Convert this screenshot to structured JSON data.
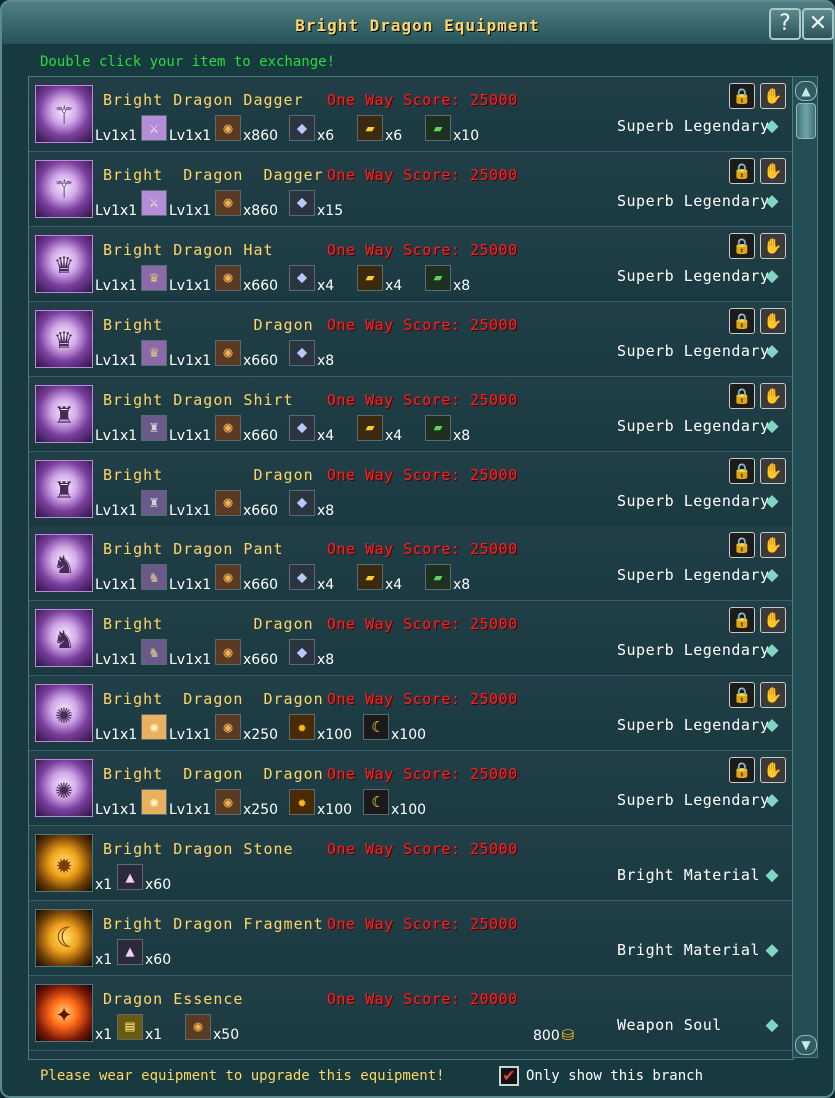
{
  "window": {
    "title": "Bright Dragon Equipment",
    "help_label": "?",
    "close_label": "✕"
  },
  "hint": "Double click your item to exchange!",
  "rows": [
    {
      "thumb": "dagger-icon",
      "thumb_glyph": "⚚",
      "name": "Bright Dragon Dagger",
      "score": "One Way Score: 25000",
      "quality": "Superb Legendary",
      "reqs": [
        {
          "pre": "Lv1x1",
          "icon": "dagger-icon",
          "glyph": "⚔",
          "cls": "ico-dagger"
        },
        {
          "pre": "Lv1x1",
          "icon": "ore-icon",
          "glyph": "◉",
          "cls": "ico-ore"
        },
        {
          "qty": "x860"
        },
        {
          "icon": "crystal-icon",
          "glyph": "⬥",
          "cls": "ico-crystal",
          "qty": "x6"
        },
        {
          "icon": "gold-bar-icon",
          "glyph": "▰",
          "cls": "ico-gold",
          "qty": "x6"
        },
        {
          "icon": "jade-icon",
          "glyph": "▰",
          "cls": "ico-jade",
          "qty": "x10"
        }
      ]
    },
    {
      "thumb": "dagger-icon",
      "thumb_glyph": "⚚",
      "name": "Bright  Dragon  Dagger",
      "score": "One Way Score: 25000",
      "quality": "Superb Legendary",
      "reqs": [
        {
          "pre": "Lv1x1",
          "icon": "dagger-icon",
          "glyph": "⚔",
          "cls": "ico-dagger"
        },
        {
          "pre": "Lv1x1",
          "icon": "ore-icon",
          "glyph": "◉",
          "cls": "ico-ore"
        },
        {
          "qty": "x860"
        },
        {
          "icon": "crystal-icon",
          "glyph": "⬥",
          "cls": "ico-crystal",
          "qty": "x15"
        }
      ]
    },
    {
      "thumb": "hat-icon",
      "thumb_glyph": "♛",
      "name": "Bright Dragon Hat",
      "score": "One Way Score: 25000",
      "quality": "Superb Legendary",
      "reqs": [
        {
          "pre": "Lv1x1",
          "icon": "hat-icon",
          "glyph": "♛",
          "cls": "ico-hat"
        },
        {
          "pre": "Lv1x1",
          "icon": "ore-icon",
          "glyph": "◉",
          "cls": "ico-ore"
        },
        {
          "qty": "x660"
        },
        {
          "icon": "crystal-icon",
          "glyph": "⬥",
          "cls": "ico-crystal",
          "qty": "x4"
        },
        {
          "icon": "gold-bar-icon",
          "glyph": "▰",
          "cls": "ico-gold",
          "qty": "x4"
        },
        {
          "icon": "jade-icon",
          "glyph": "▰",
          "cls": "ico-jade",
          "qty": "x8"
        }
      ]
    },
    {
      "thumb": "hat-icon",
      "thumb_glyph": "♛",
      "name": "Bright         Dragon",
      "score": "One Way Score: 25000",
      "quality": "Superb Legendary",
      "reqs": [
        {
          "pre": "Lv1x1",
          "icon": "hat-icon",
          "glyph": "♛",
          "cls": "ico-hat"
        },
        {
          "pre": "Lv1x1",
          "icon": "ore-icon",
          "glyph": "◉",
          "cls": "ico-ore"
        },
        {
          "qty": "x660"
        },
        {
          "icon": "crystal-icon",
          "glyph": "⬥",
          "cls": "ico-crystal",
          "qty": "x8"
        }
      ]
    },
    {
      "thumb": "shirt-icon",
      "thumb_glyph": "♜",
      "name": "Bright Dragon Shirt",
      "score": "One Way Score: 25000",
      "quality": "Superb Legendary",
      "reqs": [
        {
          "pre": "Lv1x1",
          "icon": "shirt-icon",
          "glyph": "♜",
          "cls": "ico-shirt"
        },
        {
          "pre": "Lv1x1",
          "icon": "ore-icon",
          "glyph": "◉",
          "cls": "ico-ore"
        },
        {
          "qty": "x660"
        },
        {
          "icon": "crystal-icon",
          "glyph": "⬥",
          "cls": "ico-crystal",
          "qty": "x4"
        },
        {
          "icon": "gold-bar-icon",
          "glyph": "▰",
          "cls": "ico-gold",
          "qty": "x4"
        },
        {
          "icon": "jade-icon",
          "glyph": "▰",
          "cls": "ico-jade",
          "qty": "x8"
        }
      ]
    },
    {
      "thumb": "shirt-icon",
      "thumb_glyph": "♜",
      "name": "Bright         Dragon",
      "score": "One Way Score: 25000",
      "quality": "Superb Legendary",
      "reqs": [
        {
          "pre": "Lv1x1",
          "icon": "shirt-icon",
          "glyph": "♜",
          "cls": "ico-shirt"
        },
        {
          "pre": "Lv1x1",
          "icon": "ore-icon",
          "glyph": "◉",
          "cls": "ico-ore"
        },
        {
          "qty": "x660"
        },
        {
          "icon": "crystal-icon",
          "glyph": "⬥",
          "cls": "ico-crystal",
          "qty": "x8"
        }
      ]
    },
    {
      "thumb": "pant-icon",
      "thumb_glyph": "♞",
      "name": "Bright Dragon Pant",
      "score": "One Way Score: 25000",
      "quality": "Superb Legendary",
      "reqs": [
        {
          "pre": "Lv1x1",
          "icon": "pant-icon",
          "glyph": "♞",
          "cls": "ico-pant"
        },
        {
          "pre": "Lv1x1",
          "icon": "ore-icon",
          "glyph": "◉",
          "cls": "ico-ore"
        },
        {
          "qty": "x660"
        },
        {
          "icon": "crystal-icon",
          "glyph": "⬥",
          "cls": "ico-crystal",
          "qty": "x4"
        },
        {
          "icon": "gold-bar-icon",
          "glyph": "▰",
          "cls": "ico-gold",
          "qty": "x4"
        },
        {
          "icon": "jade-icon",
          "glyph": "▰",
          "cls": "ico-jade",
          "qty": "x8"
        }
      ]
    },
    {
      "thumb": "pant-icon",
      "thumb_glyph": "♞",
      "name": "Bright         Dragon",
      "score": "One Way Score: 25000",
      "quality": "Superb Legendary",
      "reqs": [
        {
          "pre": "Lv1x1",
          "icon": "pant-icon",
          "glyph": "♞",
          "cls": "ico-pant"
        },
        {
          "pre": "Lv1x1",
          "icon": "ore-icon",
          "glyph": "◉",
          "cls": "ico-ore"
        },
        {
          "qty": "x660"
        },
        {
          "icon": "crystal-icon",
          "glyph": "⬥",
          "cls": "ico-crystal",
          "qty": "x8"
        }
      ]
    },
    {
      "thumb": "dragon-gem-icon",
      "thumb_glyph": "✺",
      "name": "Bright  Dragon  Dragon",
      "score": "One Way Score: 25000",
      "quality": "Superb Legendary",
      "reqs": [
        {
          "pre": "Lv1x1",
          "icon": "gem-icon",
          "glyph": "✺",
          "cls": "ico-gem"
        },
        {
          "pre": "Lv1x1",
          "icon": "ore-icon",
          "glyph": "◉",
          "cls": "ico-ore"
        },
        {
          "qty": "x250"
        },
        {
          "icon": "dragon-coin-icon",
          "glyph": "✹",
          "cls": "ico-coin",
          "qty": "x100"
        },
        {
          "icon": "fragment-icon",
          "glyph": "☾",
          "cls": "ico-frag",
          "qty": "x100"
        }
      ]
    },
    {
      "thumb": "dragon-gem-icon",
      "thumb_glyph": "✺",
      "name": "Bright  Dragon  Dragon",
      "score": "One Way Score: 25000",
      "quality": "Superb Legendary",
      "reqs": [
        {
          "pre": "Lv1x1",
          "icon": "gem-icon",
          "glyph": "✺",
          "cls": "ico-gem"
        },
        {
          "pre": "Lv1x1",
          "icon": "ore-icon",
          "glyph": "◉",
          "cls": "ico-ore"
        },
        {
          "qty": "x250"
        },
        {
          "icon": "dragon-coin-icon",
          "glyph": "✹",
          "cls": "ico-coin",
          "qty": "x100"
        },
        {
          "icon": "fragment-icon",
          "glyph": "☾",
          "cls": "ico-frag",
          "qty": "x100"
        }
      ]
    },
    {
      "thumb": "dragon-stone-icon",
      "thumb_glyph": "✹",
      "thumb_cls": "gold",
      "name": "Bright Dragon Stone",
      "score": "One Way Score: 25000",
      "quality": "Bright Material",
      "no_buttons": true,
      "reqs": [
        {
          "pre": "x1",
          "icon": "pyramid-icon",
          "glyph": "▲",
          "cls": "ico-pyr",
          "qty": "x60"
        }
      ]
    },
    {
      "thumb": "dragon-fragment-icon",
      "thumb_glyph": "☾",
      "thumb_cls": "gold",
      "name": "Bright Dragon Fragment",
      "score": "One Way Score: 25000",
      "quality": "Bright Material",
      "no_buttons": true,
      "reqs": [
        {
          "pre": "x1",
          "icon": "pyramid-icon",
          "glyph": "▲",
          "cls": "ico-pyr",
          "qty": "x60"
        }
      ]
    },
    {
      "thumb": "dragon-essence-icon",
      "thumb_glyph": "✦",
      "thumb_cls": "fire",
      "name": "Dragon Essence",
      "score": "One Way Score: 20000",
      "quality": "Weapon Soul",
      "no_buttons": true,
      "cost": "800",
      "reqs": [
        {
          "pre": "x1",
          "icon": "scroll-icon",
          "glyph": "▤",
          "cls": "ico-scroll",
          "qty": "x1"
        },
        {
          "icon": "ore-icon",
          "glyph": "◉",
          "cls": "ico-ore",
          "qty": "x50"
        }
      ]
    }
  ],
  "row_buttons": {
    "lock_glyph": "🔒",
    "toggle_glyph": "✋",
    "gem_glyph": "◆"
  },
  "scroll": {
    "up": "▲",
    "down": "▼"
  },
  "footer": {
    "message": "Please wear equipment to upgrade this equipment!",
    "checkbox_checked": true,
    "checkbox_glyph": "✔",
    "checkbox_label": "Only show this branch"
  },
  "colors": {
    "title": "#ffd566",
    "hint": "#2bdc3a",
    "score": "#ff1f1f",
    "background": "#163a40"
  }
}
